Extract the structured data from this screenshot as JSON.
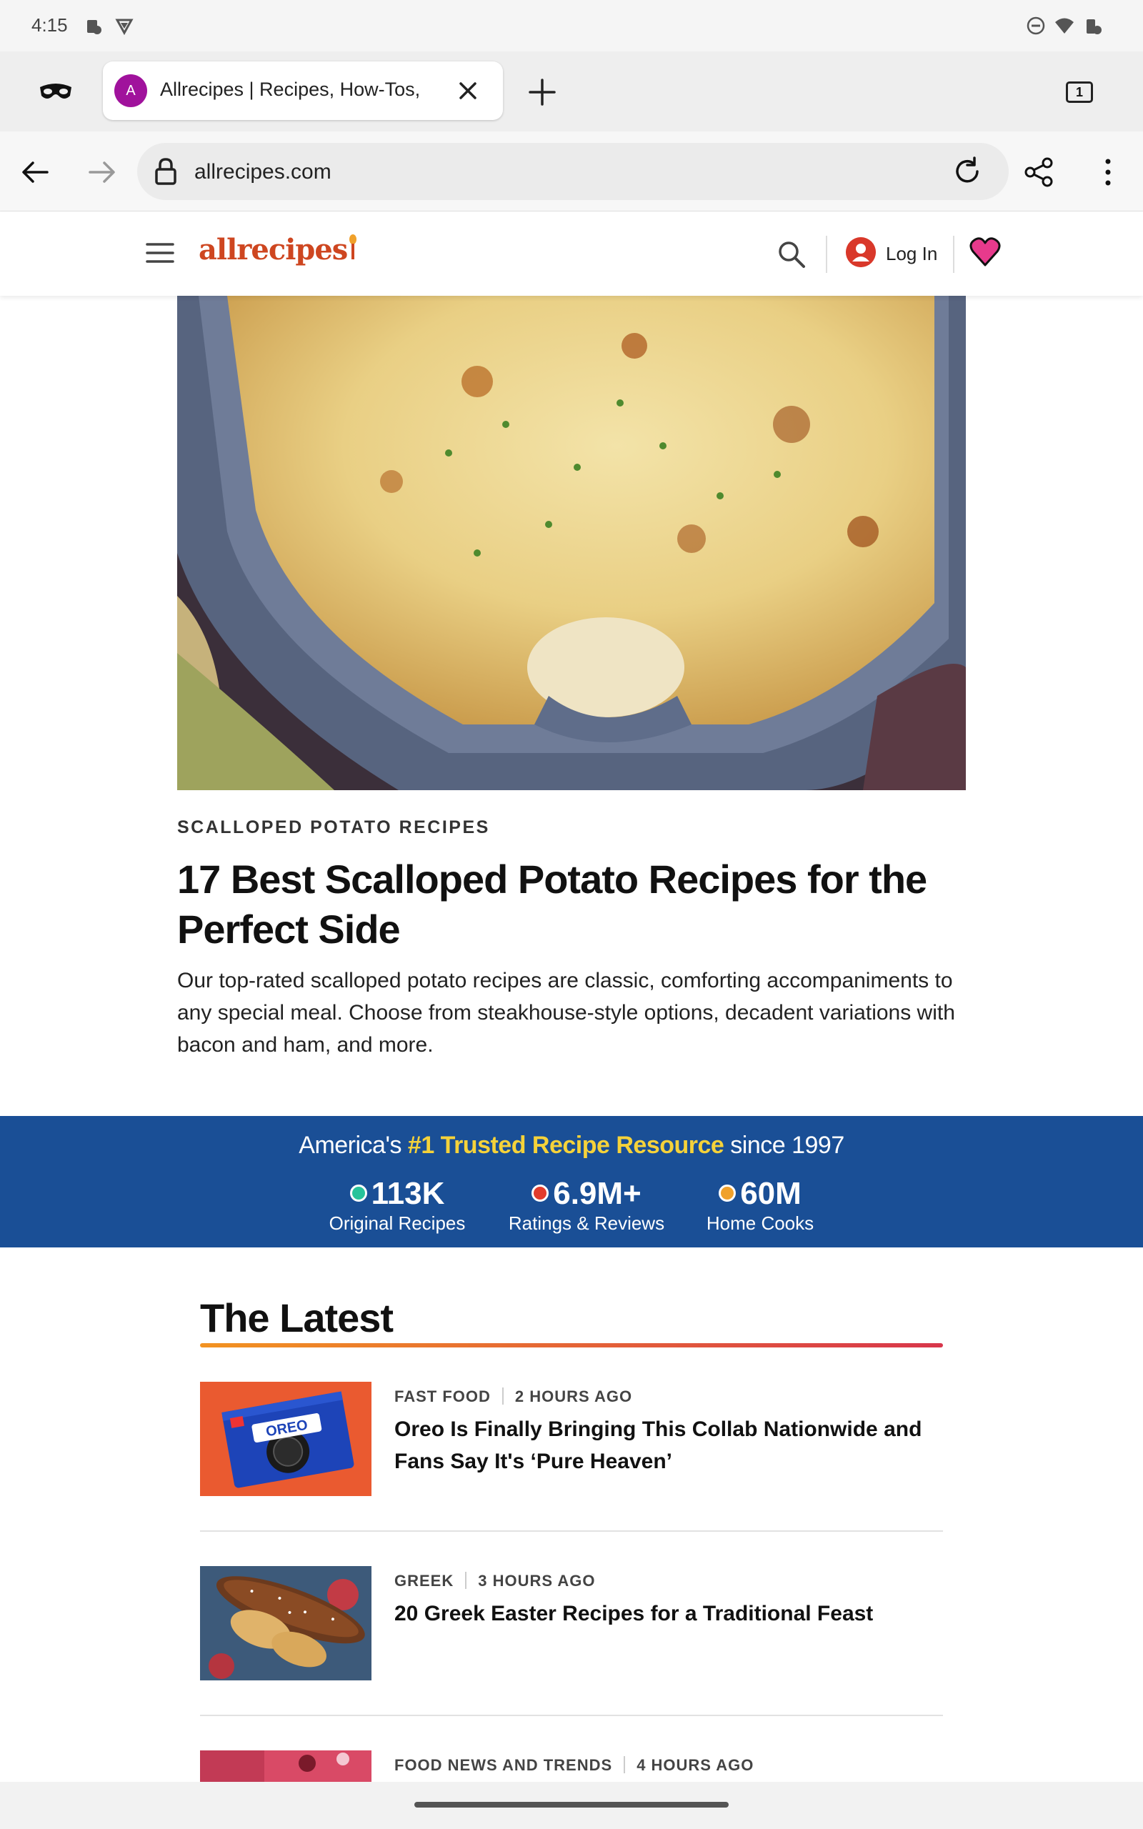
{
  "status_bar": {
    "time": "4:15"
  },
  "browser": {
    "tab": {
      "favicon_letter": "A",
      "title": "Allrecipes | Recipes, How-Tos,",
      "count": "1"
    },
    "url": "allrecipes.com"
  },
  "site": {
    "logo": "allrecipes",
    "login_label": "Log In"
  },
  "article": {
    "kicker": "SCALLOPED POTATO RECIPES",
    "headline": "17 Best Scalloped Potato Recipes for the Perfect Side",
    "dek": "Our top-rated scalloped potato recipes are classic, comforting accompaniments to any special meal. Choose from steakhouse-style options, decadent variations with bacon and ham, and more."
  },
  "banner": {
    "tag_prefix": "America's ",
    "tag_highlight": "#1 Trusted Recipe Resource",
    "tag_suffix": " since 1997",
    "stats": [
      {
        "value": "113K",
        "label": "Original Recipes",
        "dot_color": "#27c39a"
      },
      {
        "value": "6.9M+",
        "label": "Ratings & Reviews",
        "dot_color": "#e23b2c"
      },
      {
        "value": "60M",
        "label": "Home Cooks",
        "dot_color": "#f0a12b"
      }
    ]
  },
  "latest": {
    "title": "The Latest",
    "items": [
      {
        "category": "FAST FOOD",
        "time": "2 HOURS AGO",
        "title": "Oreo Is Finally Bringing This Collab Nationwide and Fans Say It's ‘Pure Heaven’",
        "thumb_label": "OREO"
      },
      {
        "category": "GREEK",
        "time": "3 HOURS AGO",
        "title": "20 Greek Easter Recipes for a Traditional Feast"
      },
      {
        "category": "FOOD NEWS AND TRENDS",
        "time": "4 HOURS AGO",
        "title": ""
      }
    ]
  },
  "colors": {
    "brand": "#ce4620",
    "banner": "#1a4f96",
    "highlight": "#f5d23a"
  }
}
